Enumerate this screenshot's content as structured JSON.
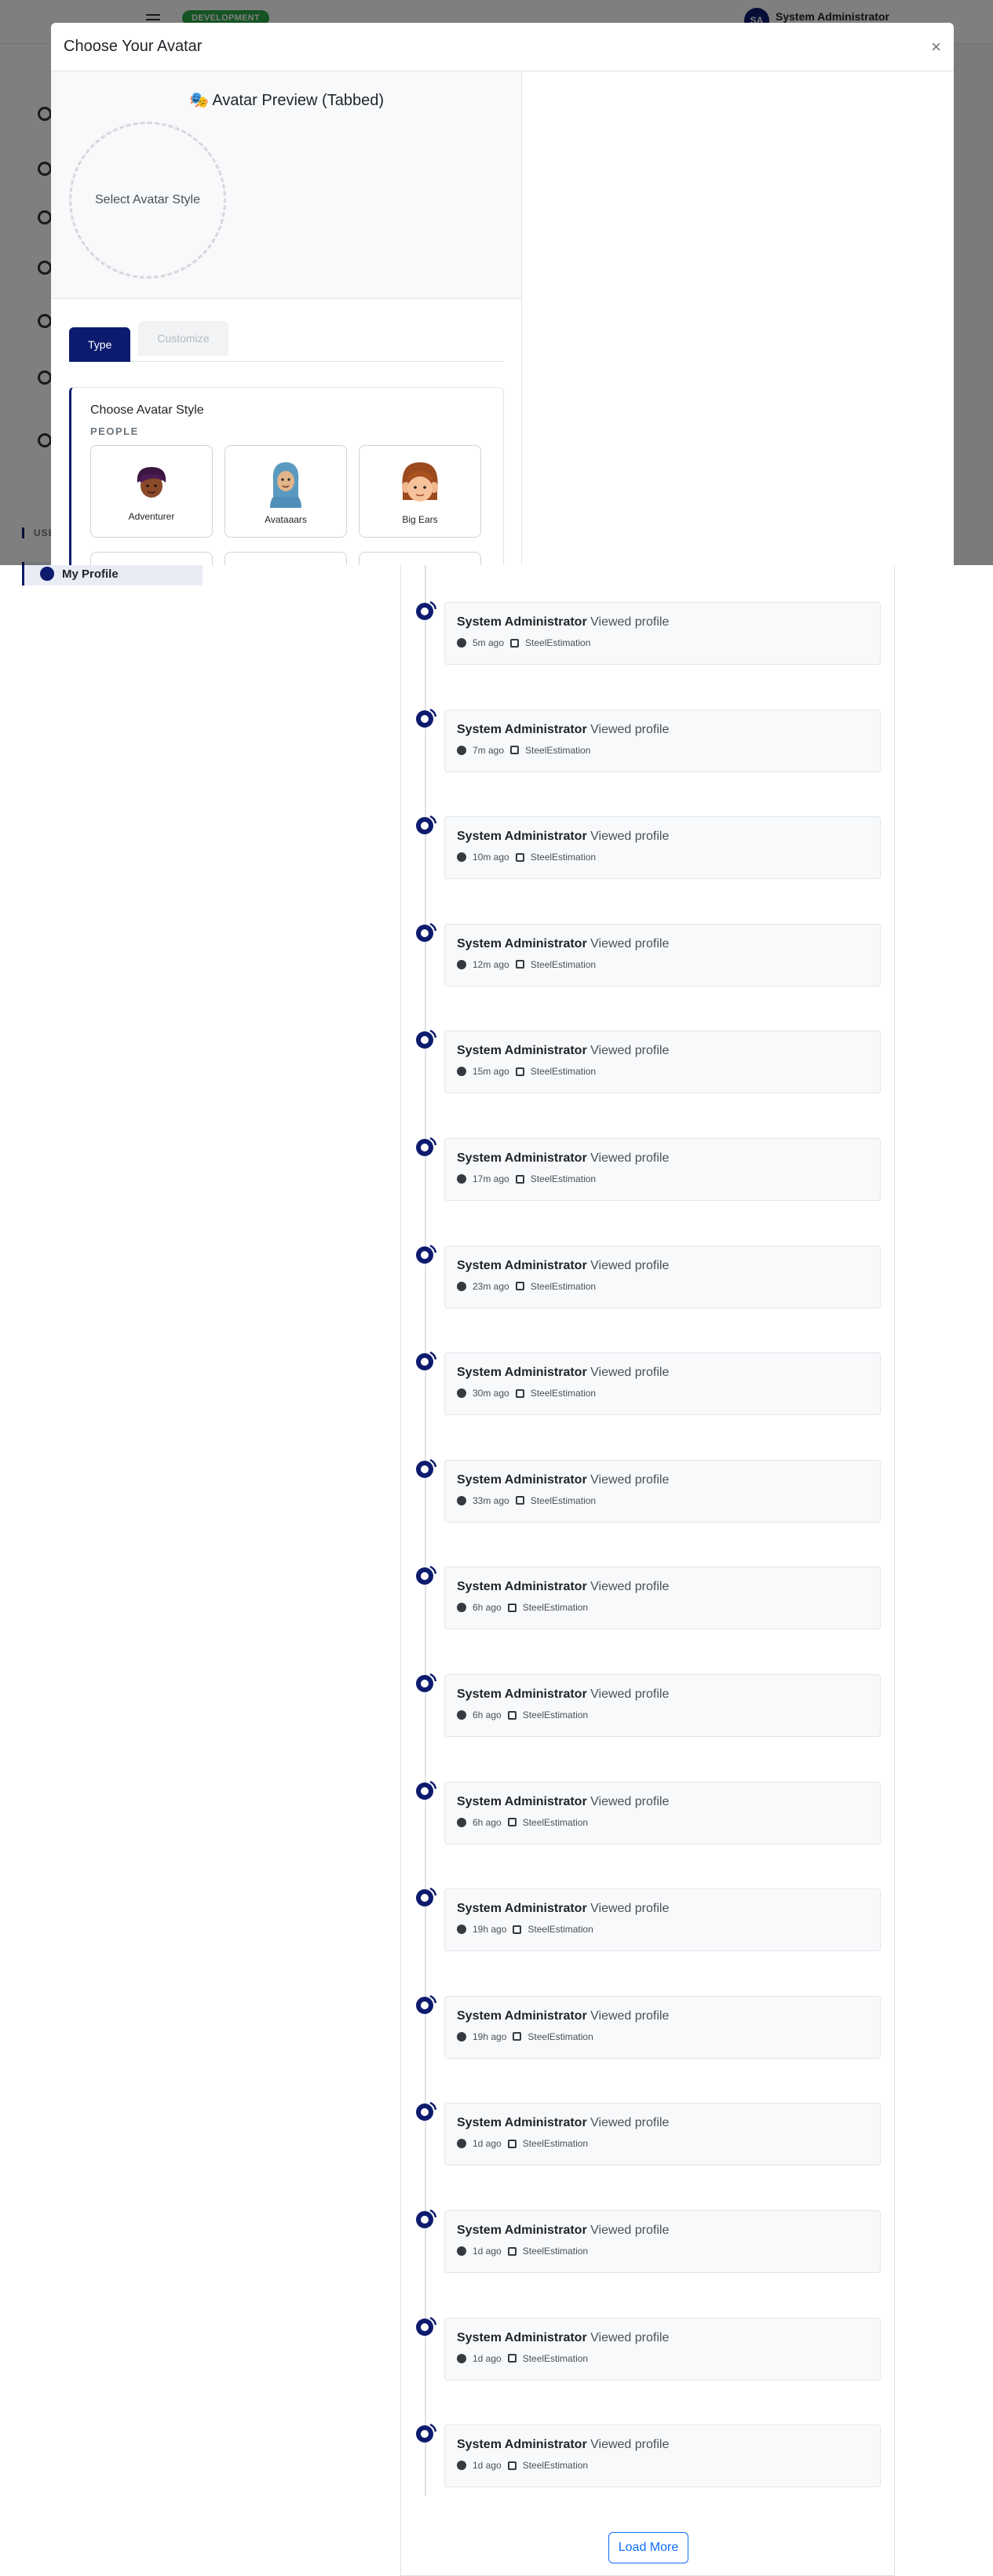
{
  "topbar": {
    "env_badge": "DEVELOPMENT",
    "user_initials": "SA",
    "user_name": "System Administrator"
  },
  "sidebar": {
    "section_label": "USE",
    "active_item": "My Profile"
  },
  "modal": {
    "title": "Choose Your Avatar",
    "close_symbol": "×",
    "preview_title": "🎭 Avatar Preview (Tabbed)",
    "preview_placeholder": "Select Avatar Style",
    "tabs": [
      "Type",
      "Customize"
    ],
    "styles_title": "Choose Avatar Style",
    "styles_group": "PEOPLE",
    "styles": [
      "Adventurer",
      "Avataaars",
      "Big Ears"
    ]
  },
  "timeline": {
    "items": [
      {
        "actor": "System Administrator",
        "action": "Viewed profile",
        "time": "5m ago",
        "source": "SteelEstimation"
      },
      {
        "actor": "System Administrator",
        "action": "Viewed profile",
        "time": "7m ago",
        "source": "SteelEstimation"
      },
      {
        "actor": "System Administrator",
        "action": "Viewed profile",
        "time": "10m ago",
        "source": "SteelEstimation"
      },
      {
        "actor": "System Administrator",
        "action": "Viewed profile",
        "time": "12m ago",
        "source": "SteelEstimation"
      },
      {
        "actor": "System Administrator",
        "action": "Viewed profile",
        "time": "15m ago",
        "source": "SteelEstimation"
      },
      {
        "actor": "System Administrator",
        "action": "Viewed profile",
        "time": "17m ago",
        "source": "SteelEstimation"
      },
      {
        "actor": "System Administrator",
        "action": "Viewed profile",
        "time": "23m ago",
        "source": "SteelEstimation"
      },
      {
        "actor": "System Administrator",
        "action": "Viewed profile",
        "time": "30m ago",
        "source": "SteelEstimation"
      },
      {
        "actor": "System Administrator",
        "action": "Viewed profile",
        "time": "33m ago",
        "source": "SteelEstimation"
      },
      {
        "actor": "System Administrator",
        "action": "Viewed profile",
        "time": "6h ago",
        "source": "SteelEstimation"
      },
      {
        "actor": "System Administrator",
        "action": "Viewed profile",
        "time": "6h ago",
        "source": "SteelEstimation"
      },
      {
        "actor": "System Administrator",
        "action": "Viewed profile",
        "time": "6h ago",
        "source": "SteelEstimation"
      },
      {
        "actor": "System Administrator",
        "action": "Viewed profile",
        "time": "19h ago",
        "source": "SteelEstimation"
      },
      {
        "actor": "System Administrator",
        "action": "Viewed profile",
        "time": "19h ago",
        "source": "SteelEstimation"
      },
      {
        "actor": "System Administrator",
        "action": "Viewed profile",
        "time": "1d ago",
        "source": "SteelEstimation"
      },
      {
        "actor": "System Administrator",
        "action": "Viewed profile",
        "time": "1d ago",
        "source": "SteelEstimation"
      },
      {
        "actor": "System Administrator",
        "action": "Viewed profile",
        "time": "1d ago",
        "source": "SteelEstimation"
      },
      {
        "actor": "System Administrator",
        "action": "Viewed profile",
        "time": "1d ago",
        "source": "SteelEstimation"
      }
    ],
    "load_more_label": "Load More"
  },
  "colors": {
    "primary": "#0d1b6e",
    "env_badge": "#28a745",
    "link": "#0d6efd"
  }
}
